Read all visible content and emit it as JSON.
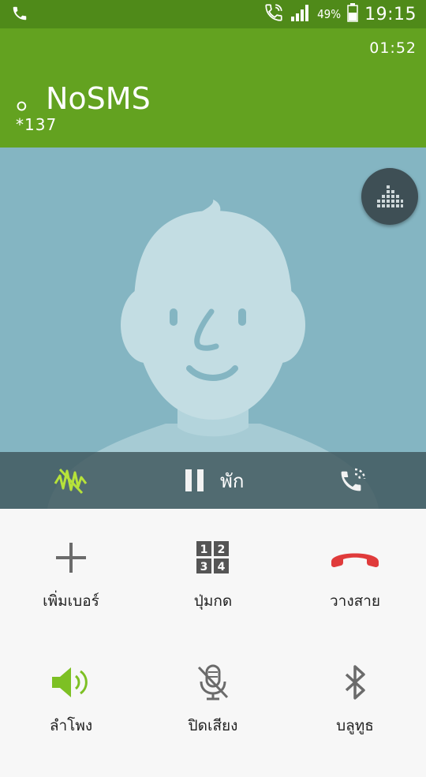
{
  "status_bar": {
    "battery_percent": "49%",
    "time": "19:15",
    "icons": [
      "phone-icon",
      "wifi-call-icon",
      "signal-icon",
      "battery-icon"
    ]
  },
  "call": {
    "duration": "01:52",
    "contact_name": "。NoSMS",
    "number": "*137"
  },
  "controls": {
    "hold_label": "พัก"
  },
  "actions": [
    {
      "label": "เพิ่มเบอร์",
      "icon": "add-call-icon"
    },
    {
      "label": "ปุ่มกด",
      "icon": "keypad-icon"
    },
    {
      "label": "วางสาย",
      "icon": "end-call-icon"
    },
    {
      "label": "ลำโพง",
      "icon": "speaker-icon"
    },
    {
      "label": "ปิดเสียง",
      "icon": "mute-icon"
    },
    {
      "label": "บลูทูธ",
      "icon": "bluetooth-icon"
    }
  ],
  "colors": {
    "header": "#63a220",
    "status_bar": "#4f8a19",
    "avatar_bg": "#84b5c2",
    "end_call": "#e03b3b",
    "speaker_active": "#7dc024"
  }
}
